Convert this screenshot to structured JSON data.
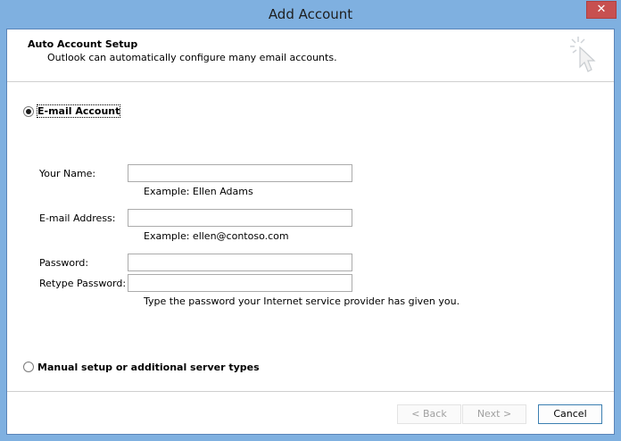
{
  "window": {
    "title": "Add Account",
    "close_glyph": "✕"
  },
  "header": {
    "title": "Auto Account Setup",
    "subtitle": "Outlook can automatically configure many email accounts.",
    "icon": "magic-wand-cursor-icon"
  },
  "email_option": {
    "label": "E-mail Account",
    "selected": true
  },
  "fields": {
    "your_name": {
      "label": "Your Name:",
      "value": "",
      "example": "Example: Ellen Adams"
    },
    "email": {
      "label": "E-mail Address:",
      "value": "",
      "example": "Example: ellen@contoso.com"
    },
    "password": {
      "label": "Password:",
      "value": ""
    },
    "retype_password": {
      "label": "Retype Password:",
      "value": "",
      "hint": "Type the password your Internet service provider has given you."
    }
  },
  "manual_option": {
    "label": "Manual setup or additional server types",
    "selected": false
  },
  "buttons": {
    "back": "< Back",
    "next": "Next >",
    "cancel": "Cancel"
  },
  "colors": {
    "titlebar": "#7fb0e0",
    "close": "#c75050",
    "primary_border": "#3c7fb1"
  }
}
